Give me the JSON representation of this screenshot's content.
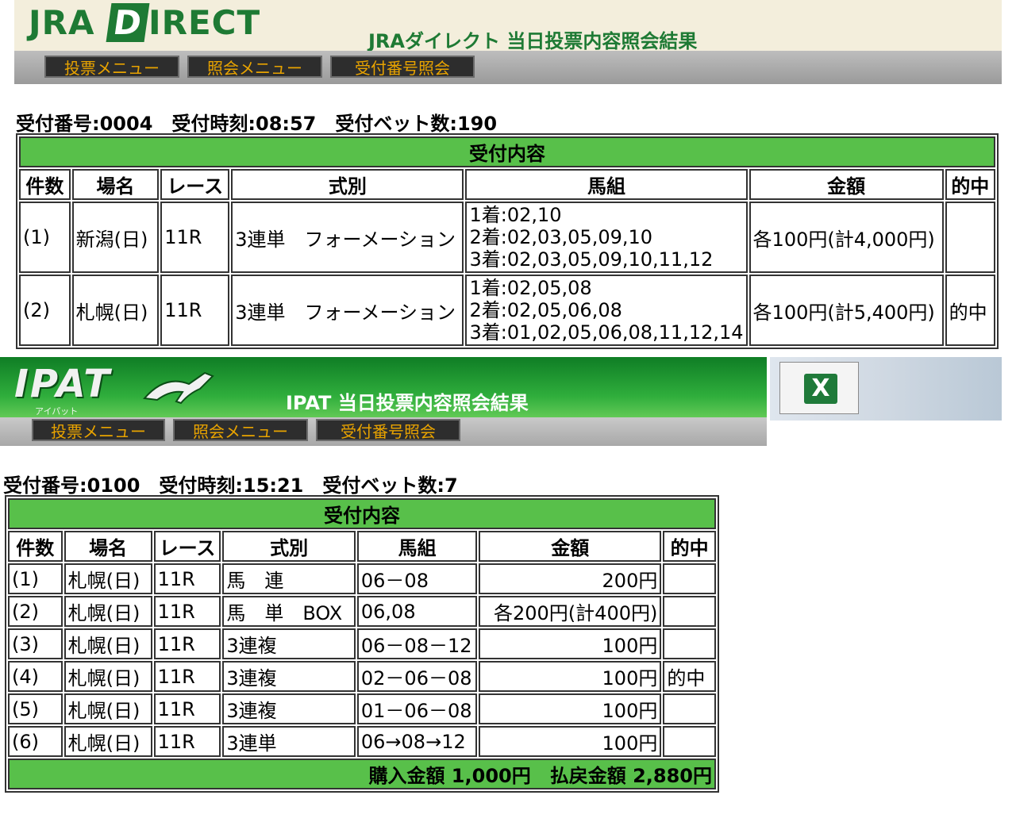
{
  "jra": {
    "logo_left": "JRA",
    "logo_d": "D",
    "logo_right": "IRECT",
    "title": "JRAダイレクト 当日投票内容照会結果",
    "menu": [
      "投票メニュー",
      "照会メニュー",
      "受付番号照会"
    ],
    "info": "受付番号:0004　受付時刻:08:57　受付ベット数:190",
    "table_title": "受付内容",
    "headers": [
      "件数",
      "場名",
      "レース",
      "式別",
      "馬組",
      "金額",
      "的中"
    ],
    "rows": [
      {
        "num": "(1)",
        "venue": "新潟(日)",
        "race": "11R",
        "type": "3連単　フォーメーション",
        "combo": [
          "1着:02,10",
          "2着:02,03,05,09,10",
          "3着:02,03,05,09,10,11,12"
        ],
        "amount": "各100円(計4,000円)",
        "hit": ""
      },
      {
        "num": "(2)",
        "venue": "札幌(日)",
        "race": "11R",
        "type": "3連単　フォーメーション",
        "combo": [
          "1着:02,05,08",
          "2着:02,05,06,08",
          "3着:01,02,05,06,08,11,12,14"
        ],
        "amount": "各100円(計5,400円)",
        "hit": "的中"
      }
    ]
  },
  "ipat": {
    "logo": "IPAT",
    "logo_sub": "アイパット",
    "title": "IPAT 当日投票内容照会結果",
    "menu": [
      "投票メニュー",
      "照会メニュー",
      "受付番号照会"
    ],
    "excel_icon": "excel-icon",
    "excel_letter": "X",
    "info": "受付番号:0100　受付時刻:15:21　受付ベット数:7",
    "table_title": "受付内容",
    "headers": [
      "件数",
      "場名",
      "レース",
      "式別",
      "馬組",
      "金額",
      "的中"
    ],
    "rows": [
      {
        "num": "(1)",
        "venue": "札幌(日)",
        "race": "11R",
        "type": "馬　連",
        "combo": "06－08",
        "amount": "200円",
        "hit": ""
      },
      {
        "num": "(2)",
        "venue": "札幌(日)",
        "race": "11R",
        "type": "馬　単　BOX",
        "combo": "06,08",
        "amount": "各200円(計400円)",
        "hit": ""
      },
      {
        "num": "(3)",
        "venue": "札幌(日)",
        "race": "11R",
        "type": "3連複",
        "combo": "06－08－12",
        "amount": "100円",
        "hit": ""
      },
      {
        "num": "(4)",
        "venue": "札幌(日)",
        "race": "11R",
        "type": "3連複",
        "combo": "02－06－08",
        "amount": "100円",
        "hit": "的中"
      },
      {
        "num": "(5)",
        "venue": "札幌(日)",
        "race": "11R",
        "type": "3連複",
        "combo": "01－06－08",
        "amount": "100円",
        "hit": ""
      },
      {
        "num": "(6)",
        "venue": "札幌(日)",
        "race": "11R",
        "type": "3連単",
        "combo": "06→08→12",
        "amount": "100円",
        "hit": ""
      }
    ],
    "summary": "購入金額 1,000円　払戻金額 2,880円"
  },
  "colors": {
    "green_bar": "#58c04a",
    "menu_text": "#e8a300",
    "jra_green": "#1e7a34"
  }
}
